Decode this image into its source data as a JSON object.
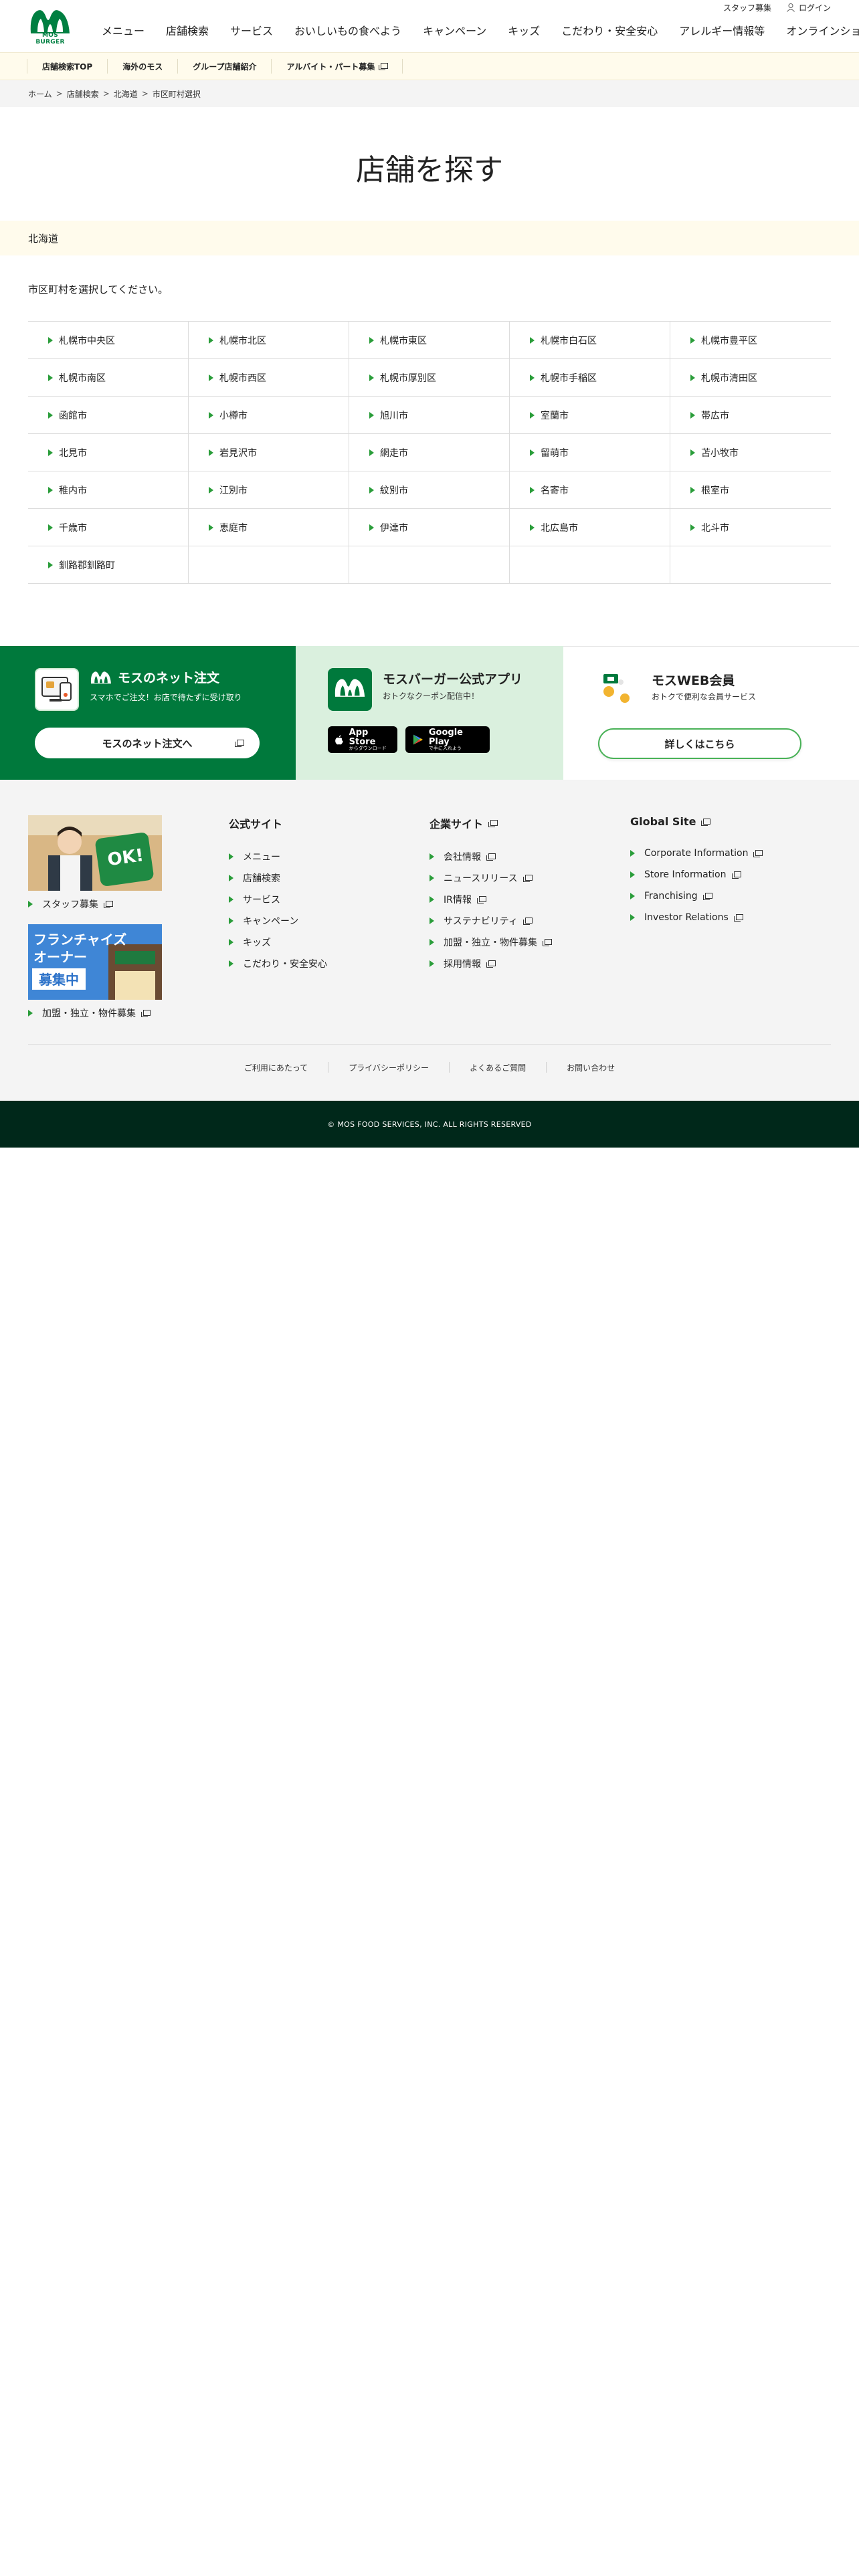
{
  "header": {
    "logo_alt": "MOS BURGER",
    "util": {
      "staff": "スタッフ募集",
      "login": "ログイン"
    },
    "gnav": [
      "メニュー",
      "店舗検索",
      "サービス",
      "おいしいもの食べよう",
      "キャンペーン",
      "キッズ",
      "こだわり・安全安心",
      "アレルギー情報等",
      "オンラインショップ"
    ]
  },
  "subnav": [
    "店舗検索TOP",
    "海外のモス",
    "グループ店舗紹介",
    "アルバイト・パート募集"
  ],
  "breadcrumb": [
    "ホーム",
    "店舗検索",
    "北海道",
    "市区町村選択"
  ],
  "page_title": "店舗を探す",
  "region": "北海道",
  "instruction": "市区町村を選択してください。",
  "cities": [
    "札幌市中央区",
    "札幌市北区",
    "札幌市東区",
    "札幌市白石区",
    "札幌市豊平区",
    "札幌市南区",
    "札幌市西区",
    "札幌市厚別区",
    "札幌市手稲区",
    "札幌市清田区",
    "函館市",
    "小樽市",
    "旭川市",
    "室蘭市",
    "帯広市",
    "北見市",
    "岩見沢市",
    "網走市",
    "留萌市",
    "苫小牧市",
    "稚内市",
    "江別市",
    "紋別市",
    "名寄市",
    "根室市",
    "千歳市",
    "恵庭市",
    "伊達市",
    "北広島市",
    "北斗市",
    "釧路郡釧路町",
    "",
    "",
    "",
    ""
  ],
  "promo": {
    "net": {
      "title": "モスのネット注文",
      "sub": "スマホでご注文！お店で待たずに受け取り",
      "button": "モスのネット注文へ"
    },
    "app": {
      "title": "モスバーガー公式アプリ",
      "sub": "おトクなクーポン配信中！",
      "appstore": "App Store",
      "appstore_sub": "からダウンロード",
      "googleplay": "Google Play",
      "googleplay_sub": "で手に入れよう"
    },
    "web": {
      "title": "モスWEB会員",
      "sub": "おトクで便利な会員サービス",
      "button": "詳しくはこちら"
    }
  },
  "footer": {
    "staff_label": "スタッフ募集",
    "staff_photo_text": "OK!",
    "fc_label": "加盟・独立・物件募集",
    "fc_photo_line1": "フランチャイズ",
    "fc_photo_line2": "オーナー",
    "fc_photo_line3": "募集中",
    "official": {
      "title": "公式サイト",
      "items": [
        "メニュー",
        "店舗検索",
        "サービス",
        "キャンペーン",
        "キッズ",
        "こだわり・安全安心"
      ]
    },
    "corporate": {
      "title": "企業サイト",
      "items": [
        "会社情報",
        "ニュースリリース",
        "IR情報",
        "サステナビリティ",
        "加盟・独立・物件募集",
        "採用情報"
      ]
    },
    "global": {
      "title": "Global Site",
      "items": [
        "Corporate Information",
        "Store Information",
        "Franchising",
        "Investor Relations"
      ]
    },
    "bottom_links": [
      "ご利用にあたって",
      "プライバシーポリシー",
      "よくあるご質問",
      "お問い合わせ"
    ],
    "copyright": "© MOS FOOD SERVICES, INC. ALL RIGHTS RESERVED"
  },
  "colors": {
    "brand_green": "#00793c",
    "light_green": "#daf0de",
    "cream": "#fffbec",
    "dark_footer": "#00281a"
  }
}
